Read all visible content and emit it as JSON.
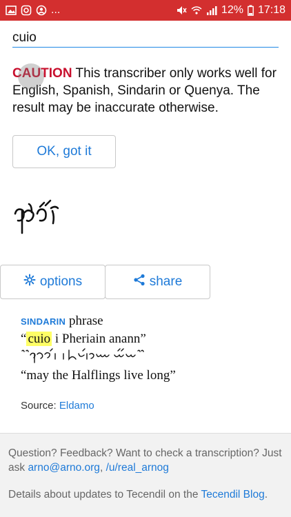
{
  "status_bar": {
    "left_icons": [
      "image-icon",
      "instagram-icon",
      "account-icon"
    ],
    "ellipsis": "...",
    "battery_percent": "12%",
    "time": "17:18"
  },
  "search": {
    "value": "cuio"
  },
  "caution": {
    "label": "CAUTION",
    "message": " This transcriber only works well for English, Spanish, Sindarin or Quenya. The result may be inaccurate otherwise."
  },
  "ok_button": {
    "label": "OK, got it"
  },
  "actions": {
    "options_label": "options",
    "share_label": "share"
  },
  "phrase": {
    "language": "SINDARIN",
    "type": "phrase",
    "open_quote": "“",
    "highlight": "cuio",
    "rest": " i Pheriain anann”",
    "translation": "“may the Halflings live long”"
  },
  "source": {
    "label": "Source:",
    "link": "Eldamo"
  },
  "footer": {
    "question": "Question? Feedback? Want to check a transcription? Just ask",
    "email": "arno@arno.org",
    "sep": ",",
    "reddit": "/u/real_arnog",
    "details": "Details about updates to Tecendil on the",
    "blog_link": "Tecendil Blog",
    "end": "."
  }
}
